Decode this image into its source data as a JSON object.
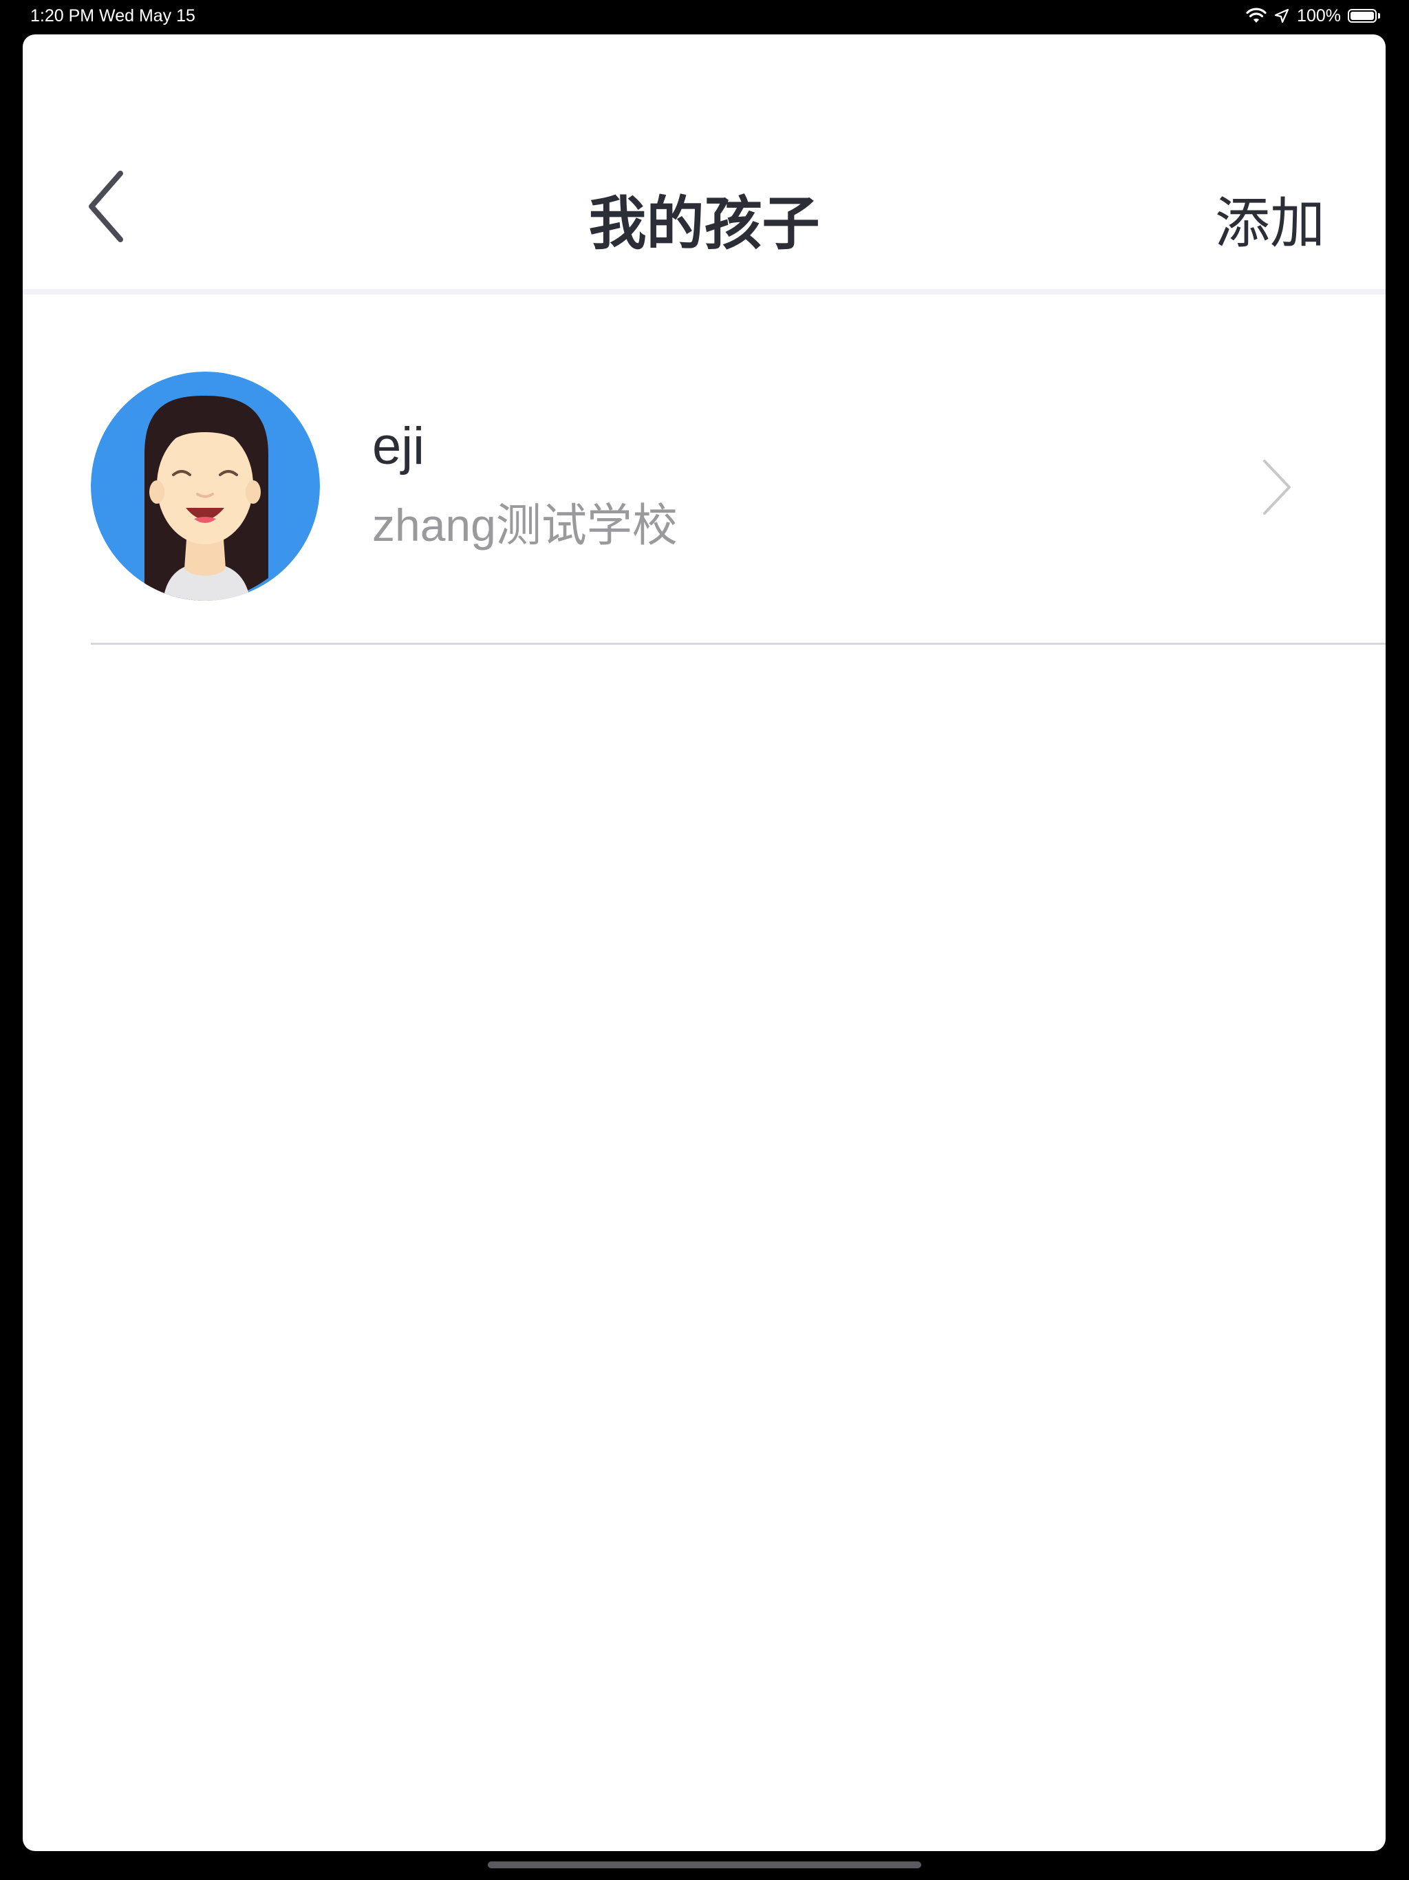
{
  "status_bar": {
    "time_date": "1:20 PM   Wed May 15",
    "battery_percent": "100%",
    "battery_level": 1.0,
    "icons": [
      "wifi-icon",
      "location-arrow-icon",
      "battery-icon"
    ]
  },
  "nav": {
    "title": "我的孩子",
    "add_label": "添加",
    "back_icon": "chevron-left-icon"
  },
  "children": [
    {
      "name": "eji",
      "school": "zhang测试学校",
      "avatar": "girl-avatar-icon",
      "chevron": "chevron-right-icon"
    }
  ],
  "colors": {
    "avatar_bg": "#3b95ec",
    "title_text": "#2b2e36",
    "secondary_text": "#9a9a9c",
    "divider": "#d8d8dc",
    "chevron": "#c8c8cc"
  }
}
